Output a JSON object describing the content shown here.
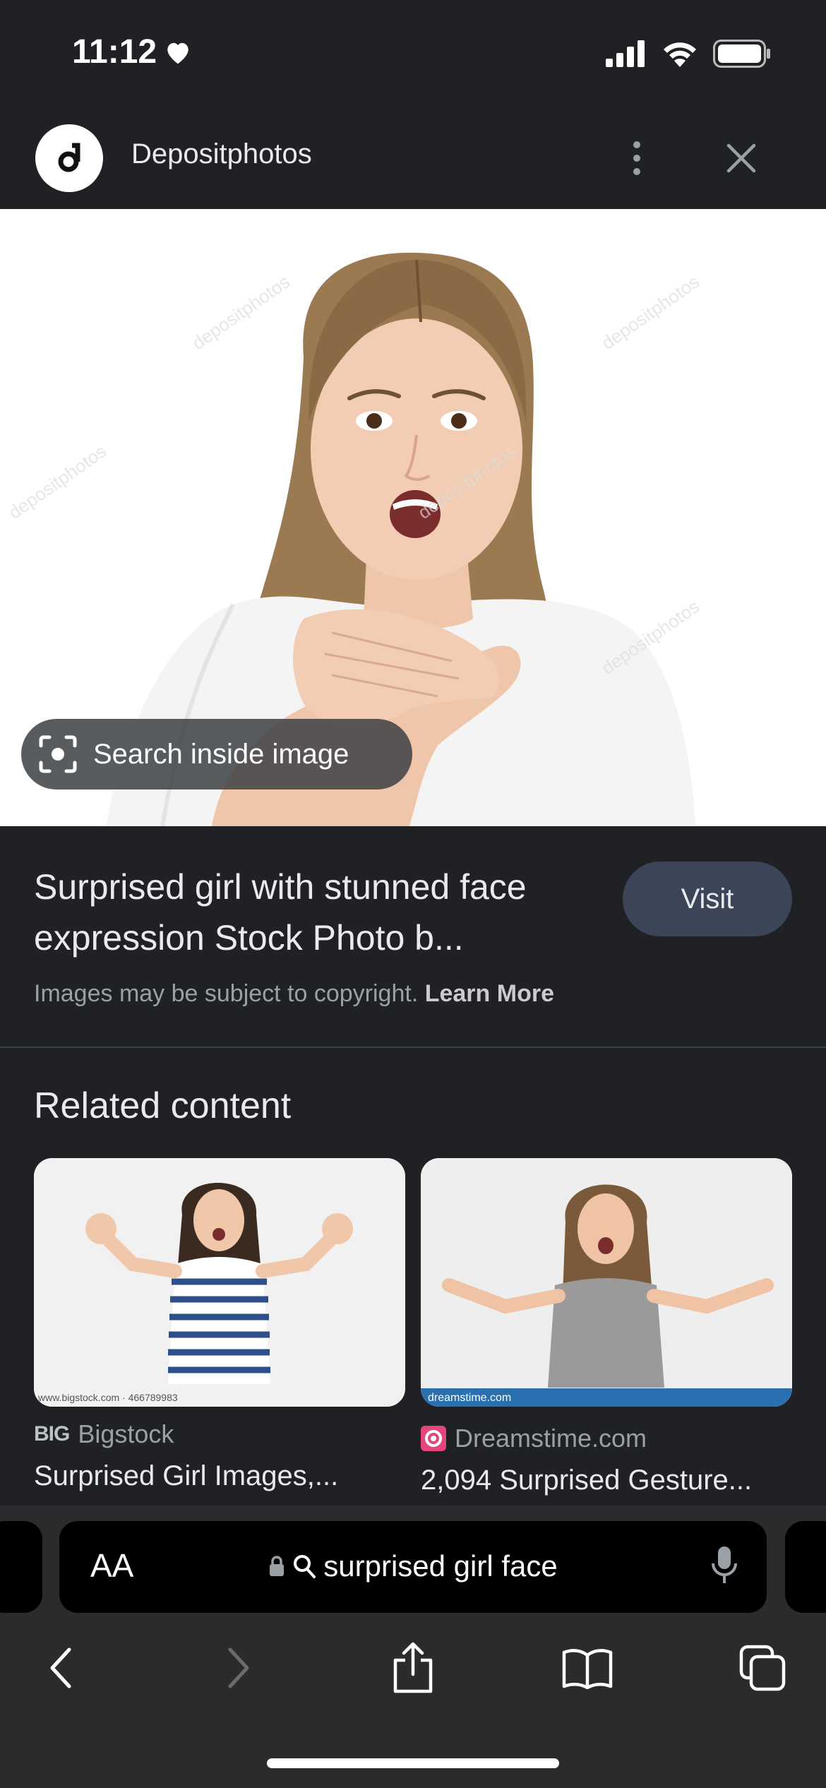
{
  "status": {
    "time": "11:12"
  },
  "header": {
    "site_name": "Depositphotos"
  },
  "image": {
    "search_inside_label": "Search inside image",
    "watermark": "depositphotos"
  },
  "result": {
    "title": "Surprised girl with stunned face expression Stock Photo b...",
    "visit_label": "Visit",
    "copyright_text": "Images may be subject to copyright.",
    "learn_more": "Learn More"
  },
  "related": {
    "title": "Related content",
    "cards": [
      {
        "source_badge": "BIG",
        "source": "Bigstock",
        "caption": "Surprised Girl Images,...",
        "image_credit": "www.bigstock.com · 466789983"
      },
      {
        "source": "Dreamstime.com",
        "caption": "2,094 Surprised Gesture...",
        "image_credit": "dreamstime.com"
      }
    ]
  },
  "browser": {
    "aa_label": "AA",
    "address_text": "surprised girl face"
  },
  "colors": {
    "background": "#202124",
    "visit_button": "#3c4557",
    "browser_bar": "#2b2b2d"
  }
}
